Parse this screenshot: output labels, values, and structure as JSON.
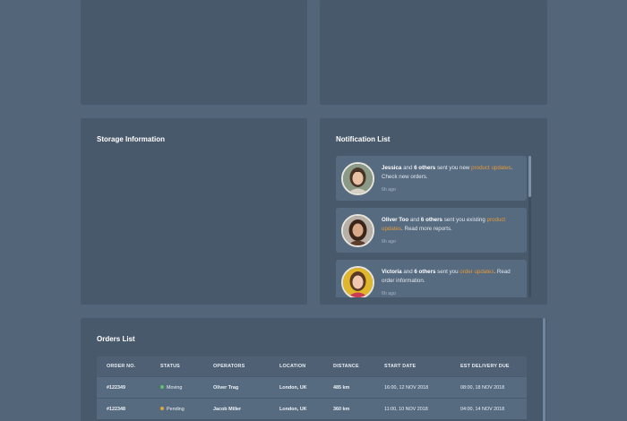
{
  "storage": {
    "title": "Storage Information"
  },
  "notifications": {
    "title": "Notification List",
    "items": [
      {
        "name": "Jessica",
        "others": "6 others",
        "pre": " sent you new ",
        "link": "product updates",
        "post": ". Check new orders.",
        "time": "6h ago",
        "joiner": " and "
      },
      {
        "name": "Oliver Too",
        "others": "6 others",
        "pre": " sent you existing ",
        "link": "product updates",
        "post": ". Read more reports.",
        "time": "6h ago",
        "joiner": " and "
      },
      {
        "name": "Victoria",
        "others": "6 others",
        "pre": " sent you ",
        "link": "order updates",
        "post": ". Read order information.",
        "time": "6h ago",
        "joiner": " and "
      }
    ]
  },
  "orders": {
    "title": "Orders List",
    "columns": [
      "ORDER NO.",
      "STATUS",
      "OPERATORS",
      "LOCATION",
      "DISTANCE",
      "START DATE",
      "EST DELIVERY DUE"
    ],
    "rows": [
      {
        "order_no": "#122349",
        "status": "Moving",
        "status_color": "#5cc36a",
        "operator": "Oliver Trag",
        "location": "London, UK",
        "distance": "485 km",
        "start_date": "16:00, 12 NOV 2018",
        "due": "08:00, 18 NOV 2018"
      },
      {
        "order_no": "#122348",
        "status": "Pending",
        "status_color": "#e3a53a",
        "operator": "Jacob Miller",
        "location": "London, UK",
        "distance": "360 km",
        "start_date": "11:00, 10 NOV 2018",
        "due": "04:00, 14 NOV 2018"
      }
    ]
  },
  "colors": {
    "background": "#536579",
    "panel": "#49596c",
    "accent": "#e39b3a"
  }
}
